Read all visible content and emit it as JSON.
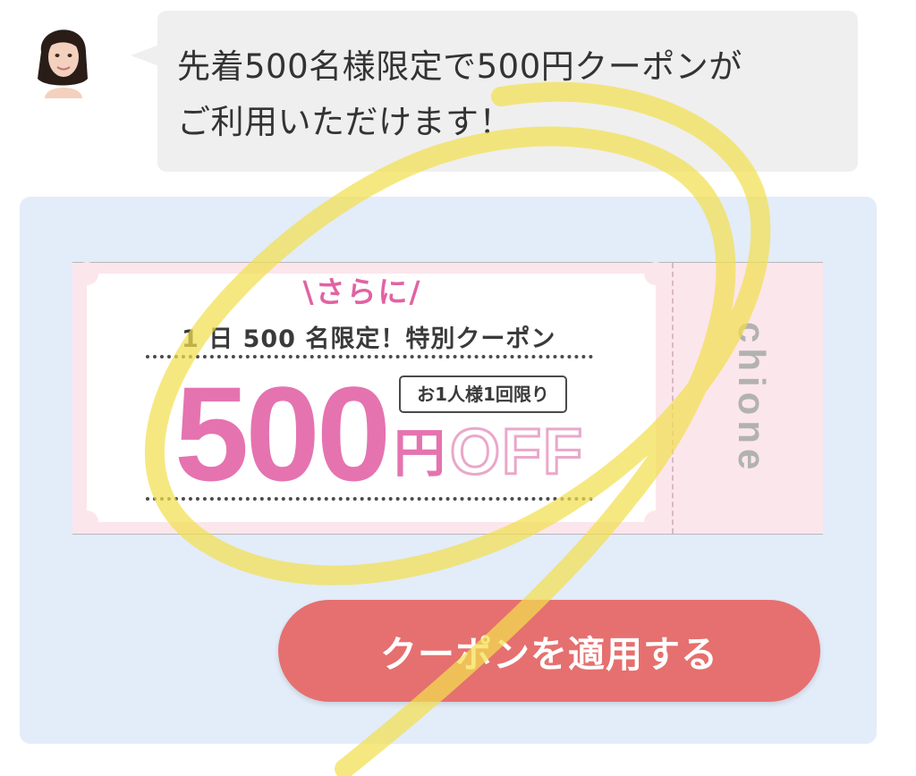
{
  "chat": {
    "line1": "先着500名様限定で500円クーポンが",
    "line2": "ご利用いただけます！"
  },
  "coupon": {
    "headline": "\\さらに/",
    "subtitle": "1 日 500 名限定！特別クーポン",
    "amount": "500",
    "yen": "円",
    "off": "OFF",
    "limit": "お1人様1回限り",
    "brand": "chione"
  },
  "apply_button": "クーポンを適用する",
  "colors": {
    "bubble_bg": "#efefef",
    "panel_bg": "#e3ecf9",
    "coupon_pink": "#e573b0",
    "button": "#e5706f",
    "highlight": "#f3df4f"
  }
}
